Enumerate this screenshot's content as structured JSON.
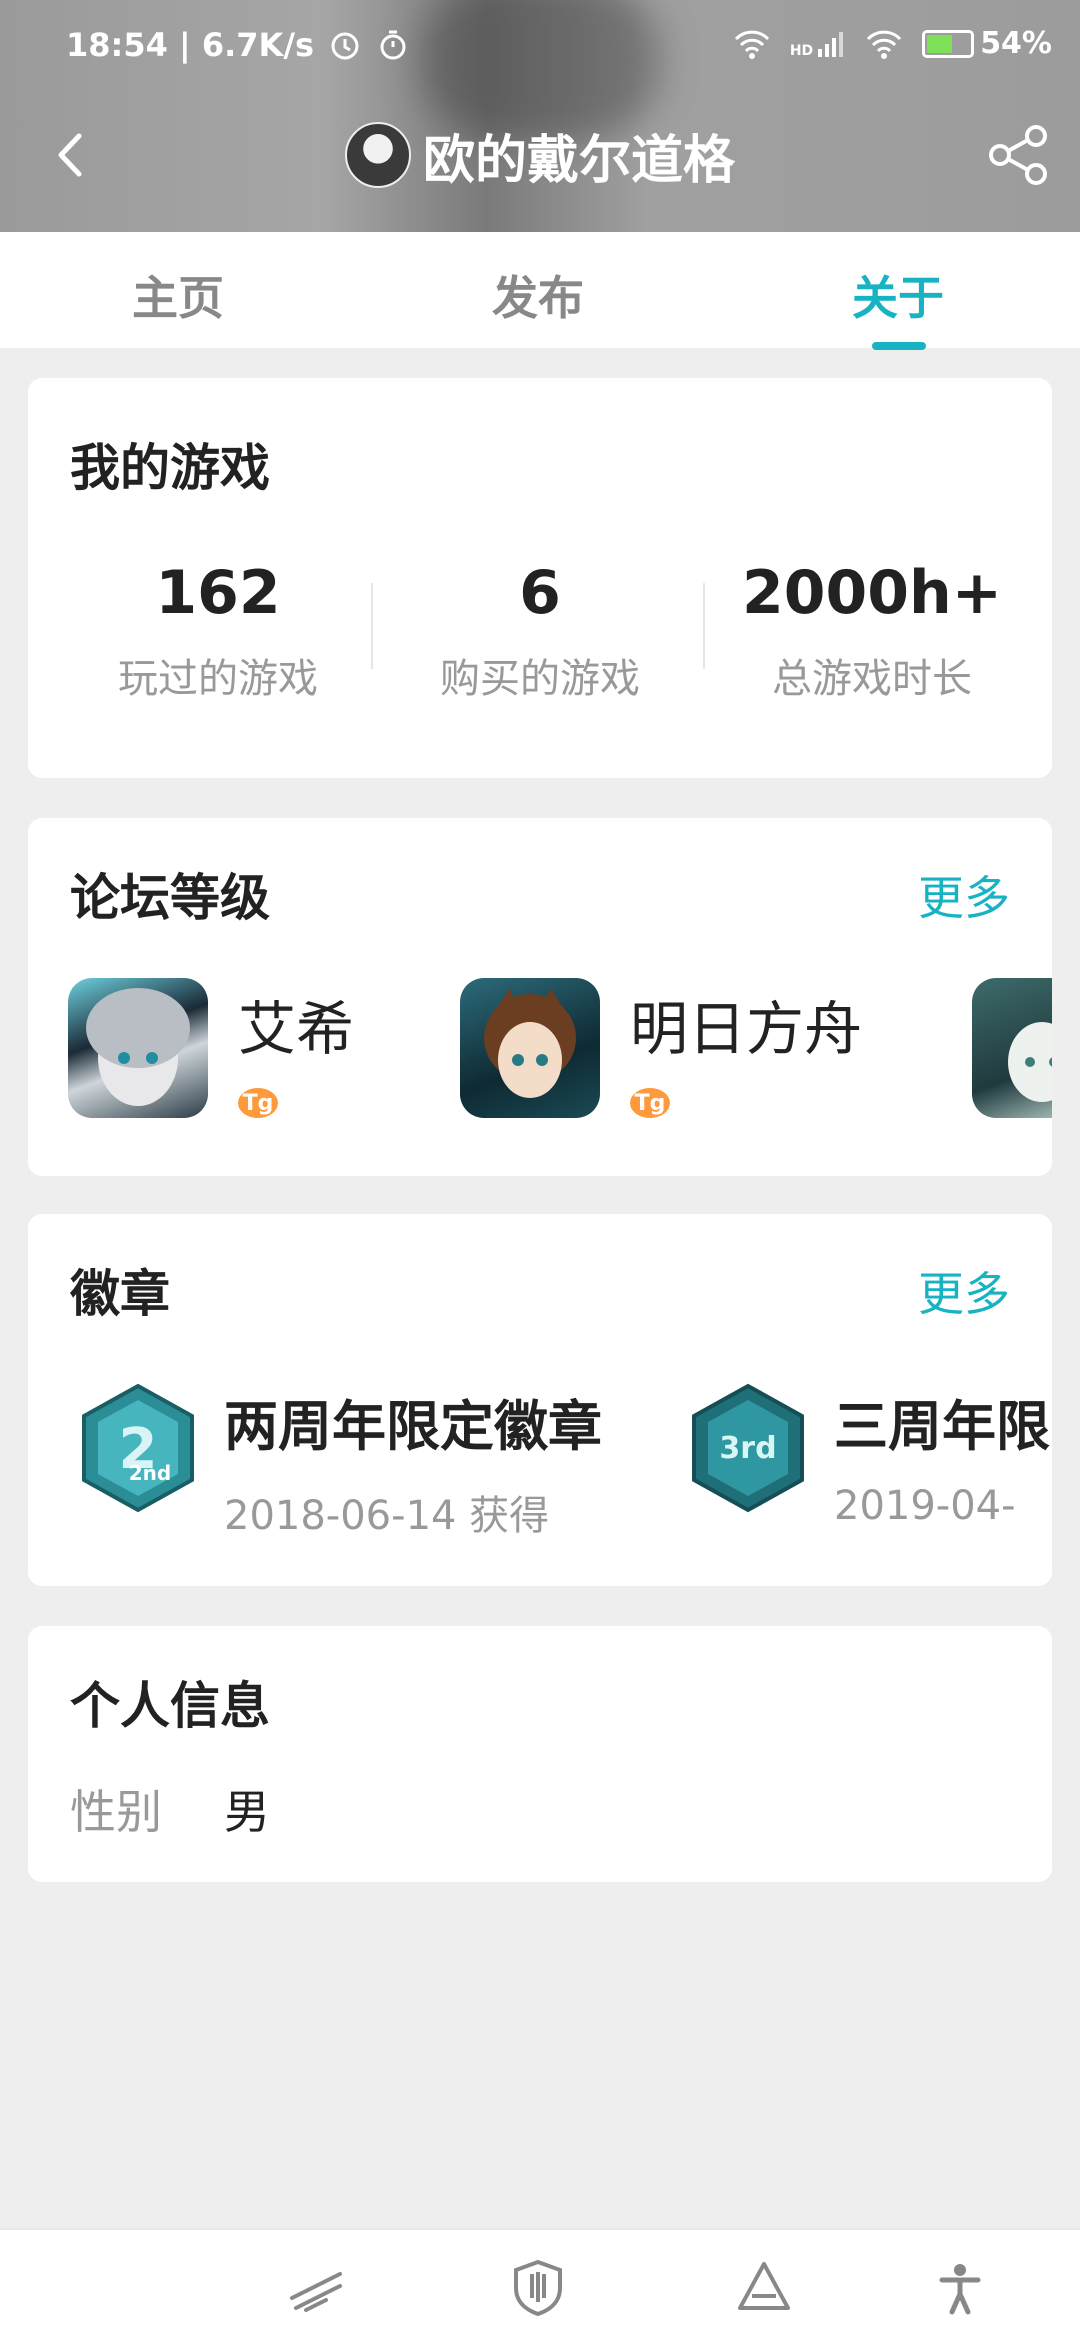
{
  "status_bar": {
    "time_speed": "18:54 | 6.7K/s",
    "network": "HD",
    "battery": "54%",
    "battery_level": 0.54
  },
  "header": {
    "title": "欧的戴尔道格",
    "back_icon": "chevron-left-icon",
    "share_icon": "share-icon"
  },
  "tabs": [
    {
      "label": "主页",
      "active": false
    },
    {
      "label": "发布",
      "active": false
    },
    {
      "label": "关于",
      "active": true
    }
  ],
  "my_games": {
    "title": "我的游戏",
    "stats": [
      {
        "value": "162",
        "label": "玩过的游戏"
      },
      {
        "value": "6",
        "label": "购买的游戏"
      },
      {
        "value": "2000h+",
        "label": "总游戏时长"
      }
    ]
  },
  "forum_level": {
    "title": "论坛等级",
    "more": "更多",
    "items": [
      {
        "name": "艾希",
        "badge": "Tg"
      },
      {
        "name": "明日方舟",
        "badge": "Tg"
      },
      {
        "name": "",
        "badge": ""
      }
    ]
  },
  "badges": {
    "title": "徽章",
    "more": "更多",
    "items": [
      {
        "name": "两周年限定徽章",
        "date": "2018-06-14 获得",
        "emblem": "2nd"
      },
      {
        "name": "三周年限",
        "date": "2019-04-",
        "emblem": "3rd"
      }
    ]
  },
  "personal_info": {
    "title": "个人信息",
    "rows": [
      {
        "key": "性别",
        "value": "男"
      }
    ]
  },
  "bottom_nav": [
    {
      "icon": "slash-lines-icon"
    },
    {
      "icon": "shield-icon"
    },
    {
      "icon": "triangle-icon"
    },
    {
      "icon": "accessibility-icon"
    }
  ],
  "colors": {
    "accent": "#17b3c3",
    "badge_orange": "#ff9a3c",
    "background": "#eeeeee"
  }
}
